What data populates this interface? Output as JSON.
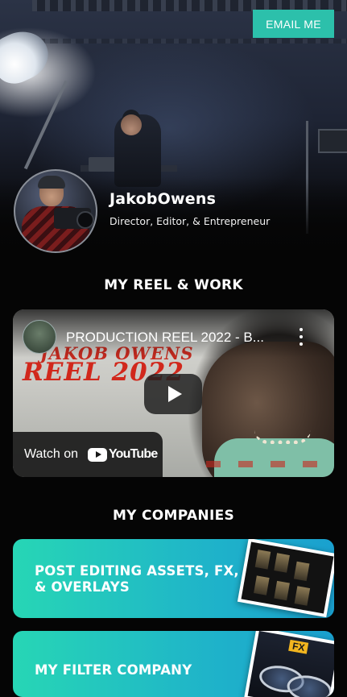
{
  "header": {
    "email_button": "EMAIL ME"
  },
  "profile": {
    "name": "JakobOwens",
    "tagline": "Director, Editor, & Entrepreneur"
  },
  "reel_section": {
    "title": "MY REEL & WORK",
    "video": {
      "title": "PRODUCTION REEL 2022 - B...",
      "overlay_line1": "JAKOB OWENS",
      "overlay_line2": "REEL 2022",
      "watch_on": "Watch on",
      "platform": "YouTube"
    }
  },
  "companies_section": {
    "title": "MY COMPANIES",
    "items": [
      {
        "label_line1": "POST EDITING ASSETS, FX,",
        "label_line2": "& OVERLAYS"
      },
      {
        "label_line1": "MY FILTER COMPANY",
        "badge": "FX"
      }
    ]
  },
  "colors": {
    "accent": "#2cc0ab",
    "card_gradient_start": "#27d6b5",
    "card_gradient_end": "#1aa0cf",
    "background": "#050505"
  },
  "icons": [
    "play-icon",
    "more-vertical-icon",
    "youtube-logo-icon"
  ]
}
